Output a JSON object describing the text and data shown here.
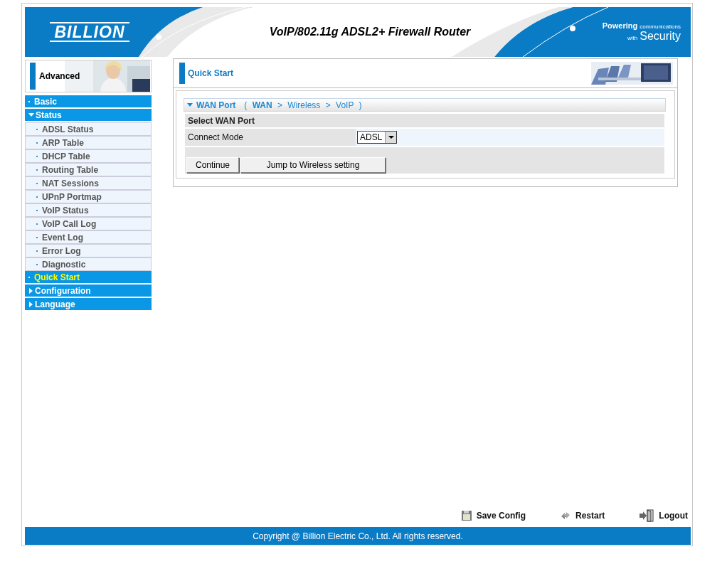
{
  "header": {
    "logo": "BILLION",
    "title": "VoIP/802.11g ADSL2+ Firewall Router",
    "tagline_top": "Powering",
    "tagline_small": "communications",
    "tagline_with": "with",
    "tagline_big": "Security"
  },
  "sidebar": {
    "mode": "Advanced",
    "items": [
      {
        "label": "Basic",
        "kind": "link",
        "selected": false
      },
      {
        "label": "Status",
        "kind": "folder",
        "expanded": true,
        "selected": false,
        "children": [
          {
            "label": "ADSL Status",
            "selected": false
          },
          {
            "label": "ARP Table",
            "selected": false
          },
          {
            "label": "DHCP Table",
            "selected": false
          },
          {
            "label": "Routing Table",
            "selected": false
          },
          {
            "label": "NAT Sessions",
            "selected": false
          },
          {
            "label": "UPnP Portmap",
            "selected": false
          },
          {
            "label": "VoIP Status",
            "selected": false
          },
          {
            "label": "VoIP Call Log",
            "selected": false
          },
          {
            "label": "Event Log",
            "selected": false
          },
          {
            "label": "Error Log",
            "selected": false
          },
          {
            "label": "Diagnostic",
            "selected": false
          }
        ]
      },
      {
        "label": "Quick Start",
        "kind": "link",
        "selected": true
      },
      {
        "label": "Configuration",
        "kind": "folder",
        "expanded": false,
        "selected": false
      },
      {
        "label": "Language",
        "kind": "folder",
        "expanded": false,
        "selected": false
      }
    ]
  },
  "content": {
    "title": "Quick Start",
    "section": {
      "title": "WAN Port",
      "steps": "( **WAN** > Wireless > VoIP )",
      "expanded": true
    },
    "form_title": "Select WAN Port",
    "fields": [
      {
        "label": "Connect Mode",
        "value": "ADSL"
      }
    ],
    "buttons": [
      "Continue",
      "Jump to Wireless setting"
    ]
  },
  "actions": [
    {
      "label": "Save Config",
      "kind": "save"
    },
    {
      "label": "Restart",
      "kind": "restart"
    },
    {
      "label": "Logout",
      "kind": "logout"
    }
  ],
  "footer": "Copyright @ Billion Electric Co., Ltd. All rights reserved."
}
